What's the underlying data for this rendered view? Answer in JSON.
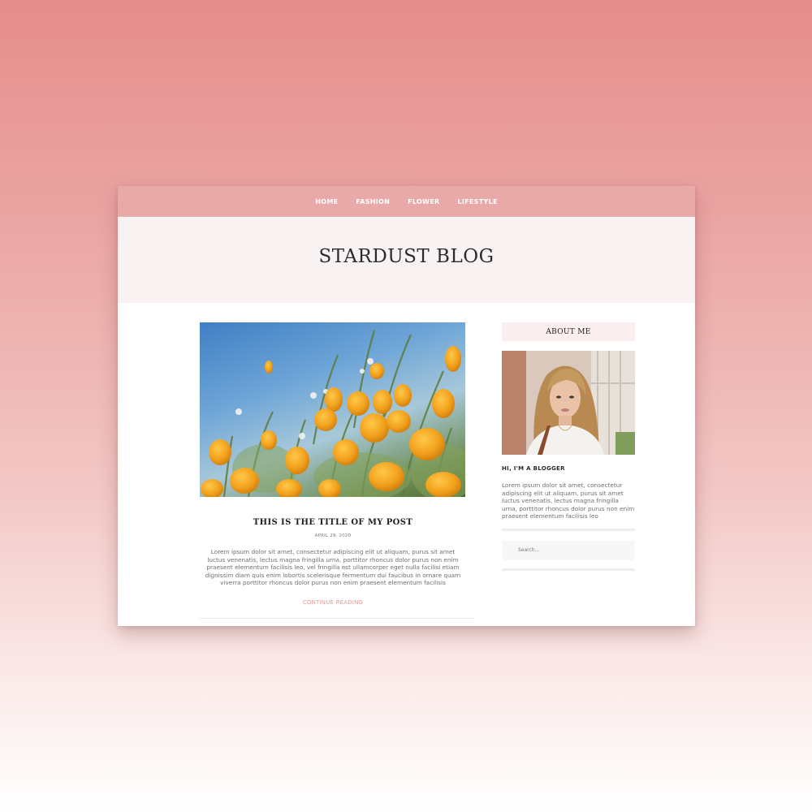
{
  "nav": {
    "items": [
      {
        "label": "HOME"
      },
      {
        "label": "FASHION"
      },
      {
        "label": "FLOWER"
      },
      {
        "label": "LIFESTYLE"
      }
    ]
  },
  "header": {
    "title": "STARDUST BLOG"
  },
  "post": {
    "image_icon": "poppy-flowers-photo",
    "title": "THIS IS THE TITLE OF MY POST",
    "date": "APRIL 29, 2020",
    "excerpt": "Lorem ipsum dolor sit amet, consectetur adipiscing elit ut aliquam, purus sit amet luctus venenatis, lectus magna fringilla urna, porttitor rhoncus dolor purus non enim praesent elementum facilisis leo, vel fringilla est ullamcorper eget nulla facilisi etiam dignissim diam quis enim lobortis scelerisque fermentum dui faucibus in ornare quam viverra porttitor rhoncus dolor purus non enim praesent elementum facilisis",
    "continue_label": "CONTINUE READING"
  },
  "sidebar": {
    "about_heading": "ABOUT ME",
    "photo_icon": "blogger-portrait-photo",
    "subtitle": "HI, I'M A BLOGGER",
    "about_text": "Lorem ipsum dolor sit amet, consectetur adipiscing elit ut aliquam, purus sit amet luctus venenatis, lectus magna fringilla urna, porttitor rhoncus dolor purus non enim praesent elementum facilisis leo",
    "search_placeholder": "Search..."
  },
  "colors": {
    "nav_bg": "#e9a9a8",
    "header_bg": "#f9f2f2",
    "accent": "#e59a94",
    "about_heading_bg": "#fbeeee"
  }
}
